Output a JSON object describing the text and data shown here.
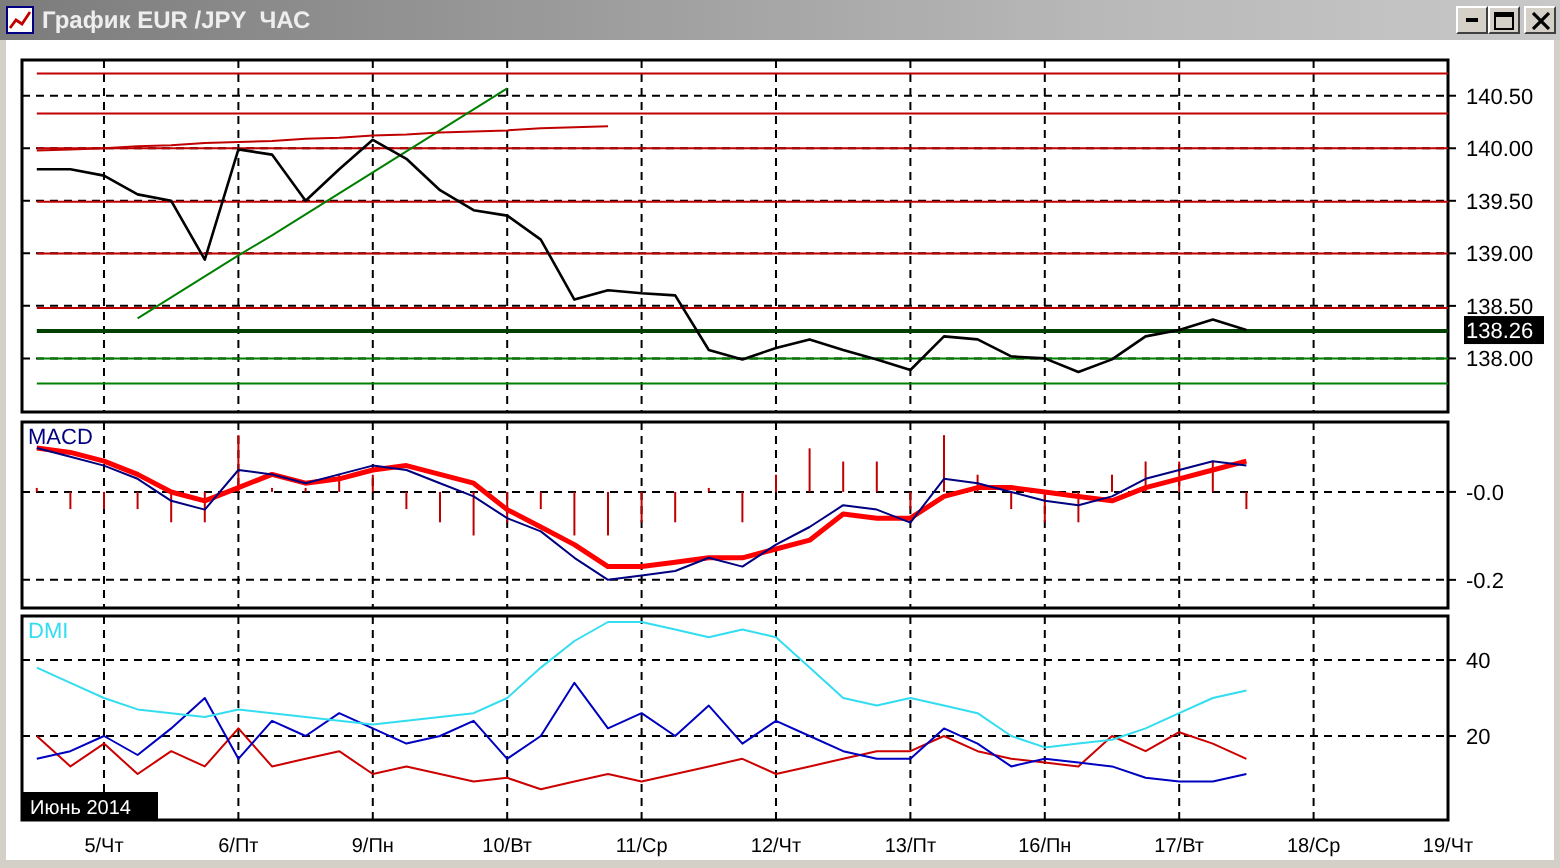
{
  "window": {
    "title": "График EUR /JPY  ЧАС"
  },
  "price_chart": {
    "current_price": "138.26",
    "chart_data": {
      "type": "line",
      "grid": true,
      "series": [
        {
          "color": "#000000",
          "values": [
            139.8,
            139.8,
            139.74,
            139.56,
            139.5,
            138.94,
            139.99,
            139.94,
            139.5,
            139.8,
            140.08,
            139.9,
            139.6,
            139.41,
            139.36,
            139.13,
            138.56,
            138.65,
            138.62,
            138.6,
            138.08,
            137.99,
            138.1,
            138.18,
            138.08,
            137.99,
            137.89,
            138.21,
            138.18,
            138.02,
            138.0,
            137.87,
            137.99,
            138.21,
            138.27,
            138.37,
            138.27,
            null,
            null,
            null,
            null,
            null,
            null
          ]
        },
        {
          "color": "#c00000",
          "values": [
            139.98,
            139.99,
            140.0,
            140.02,
            140.03,
            140.05,
            140.06,
            140.07,
            140.09,
            140.1,
            140.12,
            140.13,
            140.15,
            140.16,
            140.17,
            140.19,
            140.2,
            140.21,
            null,
            null,
            null,
            null,
            null,
            null,
            null,
            null,
            null,
            null,
            null,
            null,
            null,
            null,
            null,
            null,
            null,
            null,
            null,
            null,
            null,
            null,
            null,
            null,
            null
          ]
        },
        {
          "color": "#008000",
          "values": [
            null,
            null,
            null,
            138.38,
            138.58,
            138.78,
            138.98,
            139.17,
            139.37,
            139.57,
            139.77,
            139.97,
            140.17,
            140.37,
            140.57,
            null,
            null,
            null,
            null,
            null,
            null,
            null,
            null,
            null,
            null,
            null,
            null,
            null,
            null,
            null,
            null,
            null,
            null,
            null,
            null,
            null,
            null,
            null,
            null,
            null,
            null,
            null,
            null
          ]
        },
        {
          "color": "#c00000",
          "values": [
            140.71,
            140.71,
            140.71,
            140.71,
            140.71,
            140.71,
            140.71,
            140.71,
            140.71,
            140.71,
            140.71,
            140.71,
            140.71,
            140.71,
            140.71,
            140.71,
            140.71,
            140.71,
            140.71,
            140.71,
            140.71,
            140.71,
            140.71,
            140.71,
            140.71,
            140.71,
            140.71,
            140.71,
            140.71,
            140.71,
            140.71,
            140.71,
            140.71,
            140.71,
            140.71,
            140.71,
            140.71,
            140.71,
            140.71,
            140.71,
            140.71,
            140.71,
            140.71
          ]
        },
        {
          "color": "#c00000",
          "values": [
            140.33,
            140.33,
            140.33,
            140.33,
            140.33,
            140.33,
            140.33,
            140.33,
            140.33,
            140.33,
            140.33,
            140.33,
            140.33,
            140.33,
            140.33,
            140.33,
            140.33,
            140.33,
            140.33,
            140.33,
            140.33,
            140.33,
            140.33,
            140.33,
            140.33,
            140.33,
            140.33,
            140.33,
            140.33,
            140.33,
            140.33,
            140.33,
            140.33,
            140.33,
            140.33,
            140.33,
            140.33,
            140.33,
            140.33,
            140.33,
            140.33,
            140.33,
            140.33
          ]
        },
        {
          "color": "#c00000",
          "values": [
            140.0,
            140.0,
            140.0,
            140.0,
            140.0,
            140.0,
            140.0,
            140.0,
            140.0,
            140.0,
            140.0,
            140.0,
            140.0,
            140.0,
            140.0,
            140.0,
            140.0,
            140.0,
            140.0,
            140.0,
            140.0,
            140.0,
            140.0,
            140.0,
            140.0,
            140.0,
            140.0,
            140.0,
            140.0,
            140.0,
            140.0,
            140.0,
            140.0,
            140.0,
            140.0,
            140.0,
            140.0,
            140.0,
            140.0,
            140.0,
            140.0,
            140.0,
            140.0
          ]
        },
        {
          "color": "#c00000",
          "values": [
            139.49,
            139.49,
            139.49,
            139.49,
            139.49,
            139.49,
            139.49,
            139.49,
            139.49,
            139.49,
            139.49,
            139.49,
            139.49,
            139.49,
            139.49,
            139.49,
            139.49,
            139.49,
            139.49,
            139.49,
            139.49,
            139.49,
            139.49,
            139.49,
            139.49,
            139.49,
            139.49,
            139.49,
            139.49,
            139.49,
            139.49,
            139.49,
            139.49,
            139.49,
            139.49,
            139.49,
            139.49,
            139.49,
            139.49,
            139.49,
            139.49,
            139.49,
            139.49
          ]
        },
        {
          "color": "#c00000",
          "values": [
            139.0,
            139.0,
            139.0,
            139.0,
            139.0,
            139.0,
            139.0,
            139.0,
            139.0,
            139.0,
            139.0,
            139.0,
            139.0,
            139.0,
            139.0,
            139.0,
            139.0,
            139.0,
            139.0,
            139.0,
            139.0,
            139.0,
            139.0,
            139.0,
            139.0,
            139.0,
            139.0,
            139.0,
            139.0,
            139.0,
            139.0,
            139.0,
            139.0,
            139.0,
            139.0,
            139.0,
            139.0,
            139.0,
            139.0,
            139.0,
            139.0,
            139.0,
            139.0
          ]
        },
        {
          "color": "#c00000",
          "values": [
            138.48,
            138.48,
            138.48,
            138.48,
            138.48,
            138.48,
            138.48,
            138.48,
            138.48,
            138.48,
            138.48,
            138.48,
            138.48,
            138.48,
            138.48,
            138.48,
            138.48,
            138.48,
            138.48,
            138.48,
            138.48,
            138.48,
            138.48,
            138.48,
            138.48,
            138.48,
            138.48,
            138.48,
            138.48,
            138.48,
            138.48,
            138.48,
            138.48,
            138.48,
            138.48,
            138.48,
            138.48,
            138.48,
            138.48,
            138.48,
            138.48,
            138.48,
            138.48
          ]
        },
        {
          "color": "#004000",
          "values": [
            138.26,
            138.26,
            138.26,
            138.26,
            138.26,
            138.26,
            138.26,
            138.26,
            138.26,
            138.26,
            138.26,
            138.26,
            138.26,
            138.26,
            138.26,
            138.26,
            138.26,
            138.26,
            138.26,
            138.26,
            138.26,
            138.26,
            138.26,
            138.26,
            138.26,
            138.26,
            138.26,
            138.26,
            138.26,
            138.26,
            138.26,
            138.26,
            138.26,
            138.26,
            138.26,
            138.26,
            138.26,
            138.26,
            138.26,
            138.26,
            138.26,
            138.26,
            138.26
          ]
        },
        {
          "color": "#008000",
          "values": [
            138.0,
            138.0,
            138.0,
            138.0,
            138.0,
            138.0,
            138.0,
            138.0,
            138.0,
            138.0,
            138.0,
            138.0,
            138.0,
            138.0,
            138.0,
            138.0,
            138.0,
            138.0,
            138.0,
            138.0,
            138.0,
            138.0,
            138.0,
            138.0,
            138.0,
            138.0,
            138.0,
            138.0,
            138.0,
            138.0,
            138.0,
            138.0,
            138.0,
            138.0,
            138.0,
            138.0,
            138.0,
            138.0,
            138.0,
            138.0,
            138.0,
            138.0,
            138.0
          ]
        },
        {
          "color": "#008000",
          "values": [
            137.76,
            137.76,
            137.76,
            137.76,
            137.76,
            137.76,
            137.76,
            137.76,
            137.76,
            137.76,
            137.76,
            137.76,
            137.76,
            137.76,
            137.76,
            137.76,
            137.76,
            137.76,
            137.76,
            137.76,
            137.76,
            137.76,
            137.76,
            137.76,
            137.76,
            137.76,
            137.76,
            137.76,
            137.76,
            137.76,
            137.76,
            137.76,
            137.76,
            137.76,
            137.76,
            137.76,
            137.76,
            137.76,
            137.76,
            137.76,
            137.76,
            137.76,
            137.76
          ]
        }
      ],
      "ylim": [
        137.49,
        140.84
      ],
      "yticks": [
        {
          "value": 138,
          "label": "138.00"
        },
        {
          "value": 138.5,
          "label": "138.50"
        },
        {
          "value": 139,
          "label": "139.00"
        },
        {
          "value": 139.5,
          "label": "139.50"
        },
        {
          "value": 140,
          "label": "140.00"
        },
        {
          "value": 140.5,
          "label": "140.50"
        }
      ]
    }
  },
  "macd_chart": {
    "chart_data": {
      "type": "line",
      "title": "MACD",
      "grid": true,
      "series": [
        {
          "color": "#000080",
          "values": [
            0.1,
            0.08,
            0.06,
            0.03,
            -0.02,
            -0.04,
            0.05,
            0.04,
            0.02,
            0.04,
            0.06,
            0.05,
            0.02,
            -0.01,
            -0.06,
            -0.09,
            -0.15,
            -0.2,
            -0.19,
            -0.18,
            -0.15,
            -0.17,
            -0.12,
            -0.08,
            -0.03,
            -0.04,
            -0.07,
            0.03,
            0.02,
            0.0,
            -0.02,
            -0.03,
            -0.01,
            0.03,
            0.05,
            0.07,
            0.06,
            null,
            null,
            null,
            null,
            null,
            null
          ]
        },
        {
          "color": "#ff0000",
          "values": [
            0.1,
            0.09,
            0.07,
            0.04,
            0.0,
            -0.02,
            0.01,
            0.04,
            0.02,
            0.03,
            0.05,
            0.06,
            0.04,
            0.02,
            -0.04,
            -0.08,
            -0.12,
            -0.17,
            -0.17,
            -0.16,
            -0.15,
            -0.15,
            -0.13,
            -0.11,
            -0.05,
            -0.06,
            -0.06,
            -0.01,
            0.01,
            0.01,
            0.0,
            -0.01,
            -0.02,
            0.01,
            0.03,
            0.05,
            0.07,
            null,
            null,
            null,
            null,
            null,
            null
          ]
        }
      ],
      "ylim": [
        -0.264,
        0.159
      ],
      "yticks": [
        {
          "value": -0.2,
          "label": "-0.2"
        },
        {
          "value": 0,
          "label": "-0.0"
        }
      ]
    }
  },
  "dmi_chart": {
    "chart_data": {
      "type": "line",
      "title": "DMI",
      "grid": true,
      "categories": [
        null,
        null,
        "5/Чт",
        null,
        null,
        null,
        "6/Пт",
        null,
        null,
        null,
        "9/Пн",
        null,
        null,
        null,
        "10/Вт",
        null,
        null,
        null,
        "11/Ср",
        null,
        null,
        null,
        "12/Чт",
        null,
        null,
        null,
        "13/Пт",
        null,
        null,
        null,
        "16/Пн",
        null,
        null,
        null,
        "17/Вт",
        null,
        null,
        null,
        "18/Ср",
        null,
        null,
        null,
        "19/Чт"
      ],
      "series": [
        {
          "color": "#33ddf0",
          "values": [
            38,
            34,
            30,
            27,
            26,
            25,
            27,
            26,
            25,
            24,
            23,
            24,
            25,
            26,
            30,
            38,
            45,
            50,
            50,
            48,
            46,
            48,
            46,
            38,
            30,
            28,
            30,
            28,
            26,
            20,
            17,
            18,
            19,
            22,
            26,
            30,
            32,
            null,
            null,
            null,
            null,
            null,
            null
          ]
        },
        {
          "color": "#0000c0",
          "values": [
            14,
            16,
            20,
            15,
            22,
            30,
            14,
            24,
            20,
            26,
            22,
            18,
            20,
            24,
            14,
            20,
            34,
            22,
            26,
            20,
            28,
            18,
            24,
            20,
            16,
            14,
            14,
            22,
            18,
            12,
            14,
            13,
            12,
            9,
            8,
            8,
            10,
            null,
            null,
            null,
            null,
            null,
            null
          ]
        },
        {
          "color": "#cc0000",
          "values": [
            20,
            12,
            18,
            10,
            16,
            12,
            22,
            12,
            14,
            16,
            10,
            12,
            10,
            8,
            9,
            6,
            8,
            10,
            8,
            10,
            12,
            14,
            10,
            12,
            14,
            16,
            16,
            20,
            16,
            14,
            13,
            12,
            20,
            16,
            21,
            18,
            14,
            null,
            null,
            null,
            null,
            null,
            null
          ]
        }
      ],
      "ylim": [
        -2.1,
        51.6
      ],
      "yticks": [
        {
          "value": 20,
          "label": "20"
        },
        {
          "value": 40,
          "label": "40"
        }
      ]
    }
  },
  "time_axis": {
    "month": "Июнь 2014"
  }
}
